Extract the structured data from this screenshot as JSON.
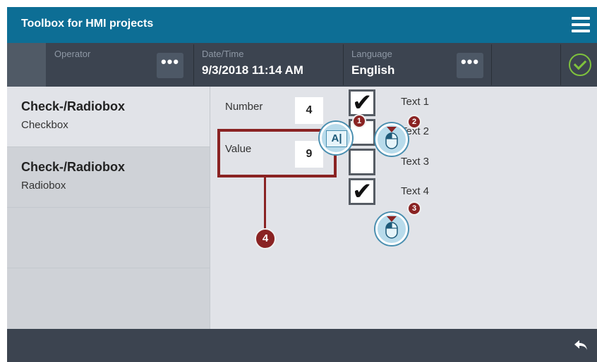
{
  "app": {
    "title": "Toolbox for HMI projects"
  },
  "status": {
    "operator_label": "Operator",
    "datetime_label": "Date/Time",
    "datetime_value": "9/3/2018 11:14 AM",
    "language_label": "Language",
    "language_value": "English",
    "more_button": "•••"
  },
  "nav": {
    "items": [
      {
        "title": "Check-/Radiobox",
        "sub": "Checkbox"
      },
      {
        "title": "Check-/Radiobox",
        "sub": "Radiobox"
      }
    ]
  },
  "content": {
    "number_label": "Number",
    "number_value": "4",
    "value_label": "Value",
    "value_value": "9",
    "checkboxes": [
      {
        "label": "Text 1",
        "checked": true
      },
      {
        "label": "Text 2",
        "checked": false
      },
      {
        "label": "Text 3",
        "checked": false
      },
      {
        "label": "Text 4",
        "checked": true
      }
    ]
  },
  "annotations": {
    "badge1": "1",
    "badge2": "2",
    "badge3": "3",
    "badge4": "4",
    "text_cursor_glyph": "A|"
  },
  "colors": {
    "title_bar": "#0d6e95",
    "status_bar": "#3c4450",
    "annotation": "#8a2323",
    "ok_green": "#7fc23d"
  }
}
